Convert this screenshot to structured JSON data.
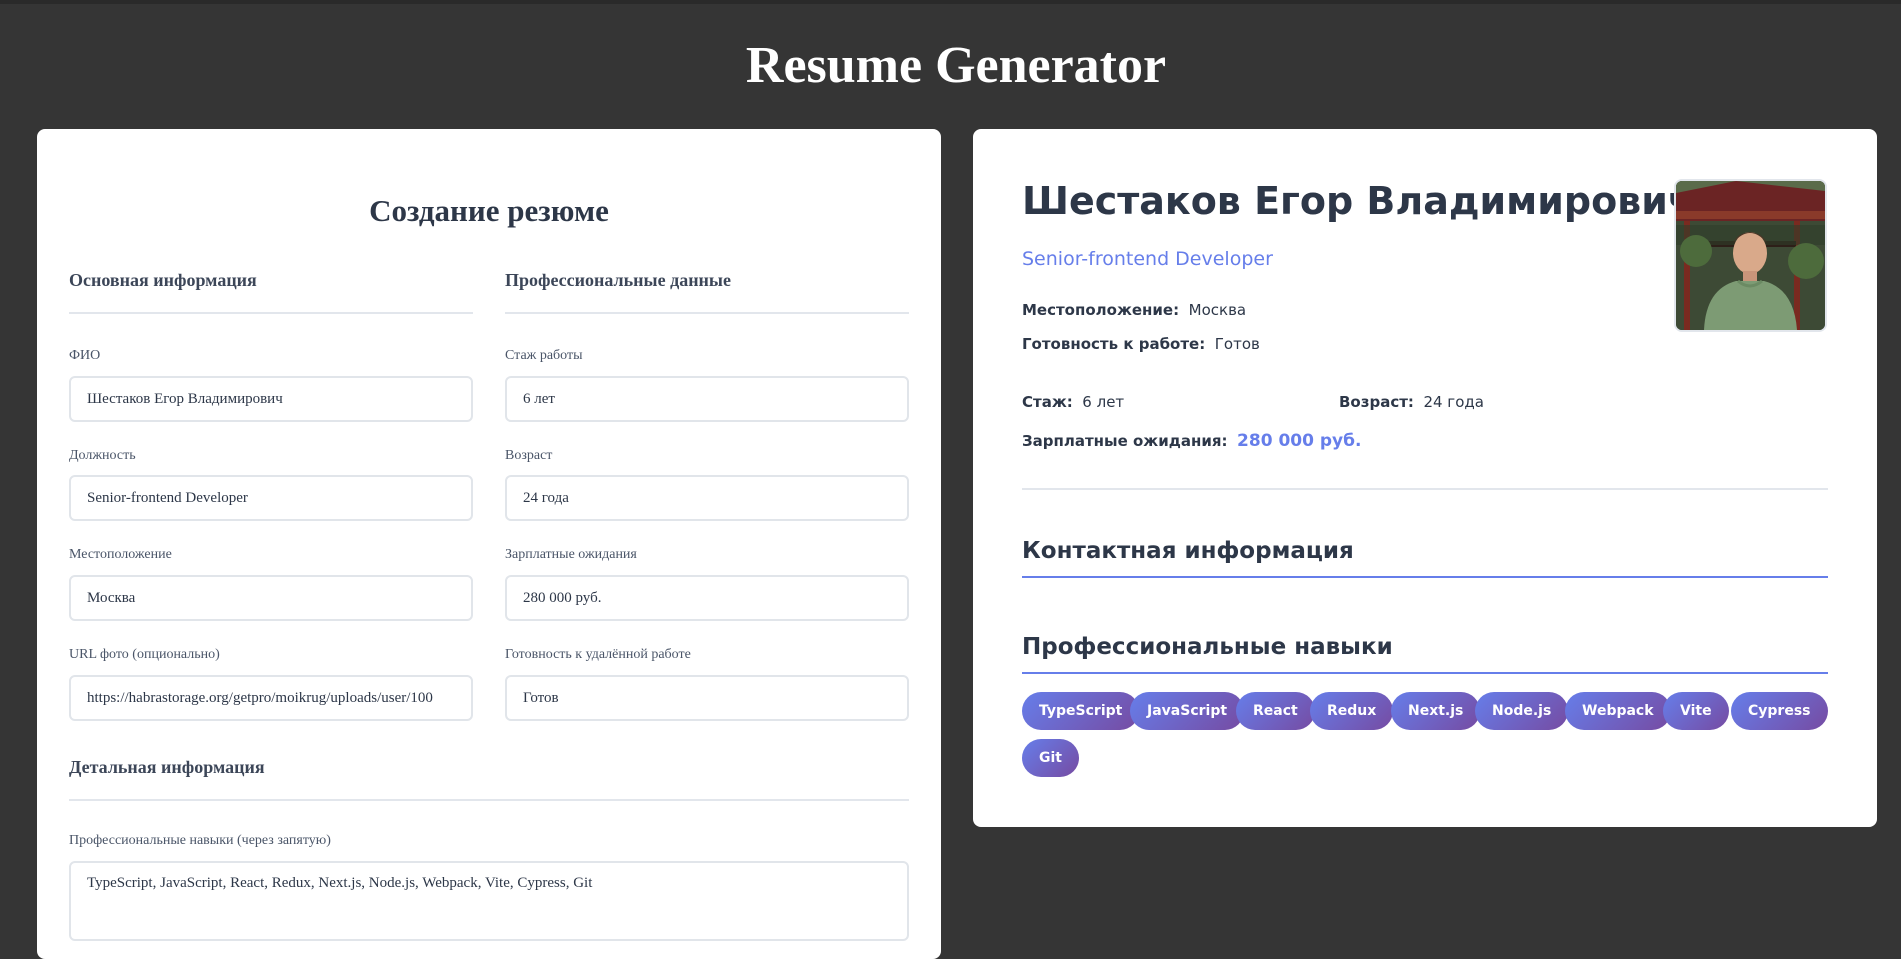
{
  "app": {
    "title": "Resume Generator"
  },
  "form": {
    "title": "Создание резюме",
    "sections": {
      "basic": "Основная информация",
      "professional": "Профессиональные данные",
      "detailed": "Детальная информация"
    },
    "fields": {
      "fio": {
        "label": "ФИО",
        "value": "Шестаков Егор Владимирович"
      },
      "position": {
        "label": "Должность",
        "value": "Senior-frontend Developer"
      },
      "location": {
        "label": "Местоположение",
        "value": "Москва"
      },
      "photo_url": {
        "label": "URL фото (опционально)",
        "value": "https://habrastorage.org/getpro/moikrug/uploads/user/100"
      },
      "experience": {
        "label": "Стаж работы",
        "value": "6 лет"
      },
      "age": {
        "label": "Возраст",
        "value": "24 года"
      },
      "salary": {
        "label": "Зарплатные ожидания",
        "value": "280 000 руб."
      },
      "remote": {
        "label": "Готовность к удалённой работе",
        "value": "Готов"
      },
      "skills": {
        "label": "Профессиональные навыки (через запятую)",
        "value": "TypeScript, JavaScript, React, Redux, Next.js, Node.js, Webpack, Vite, Cypress, Git"
      }
    }
  },
  "preview": {
    "name": "Шестаков Егор Владимирович",
    "role": "Senior-frontend Developer",
    "location": {
      "label": "Местоположение:",
      "value": "Москва"
    },
    "readiness": {
      "label": "Готовность к работе:",
      "value": "Готов"
    },
    "experience": {
      "label": "Стаж:",
      "value": "6 лет"
    },
    "age": {
      "label": "Возраст:",
      "value": "24 года"
    },
    "salary": {
      "label": "Зарплатные ожидания:",
      "value": "280 000 руб."
    },
    "contacts_title": "Контактная информация",
    "skills_title": "Профессиональные навыки",
    "skills": [
      "TypeScript",
      "JavaScript",
      "React",
      "Redux",
      "Next.js",
      "Node.js",
      "Webpack",
      "Vite",
      "Cypress",
      "Git"
    ]
  },
  "colors": {
    "background": "#353535",
    "accent": "#667eea",
    "accent2": "#764ba2",
    "text": "#2d3748"
  }
}
